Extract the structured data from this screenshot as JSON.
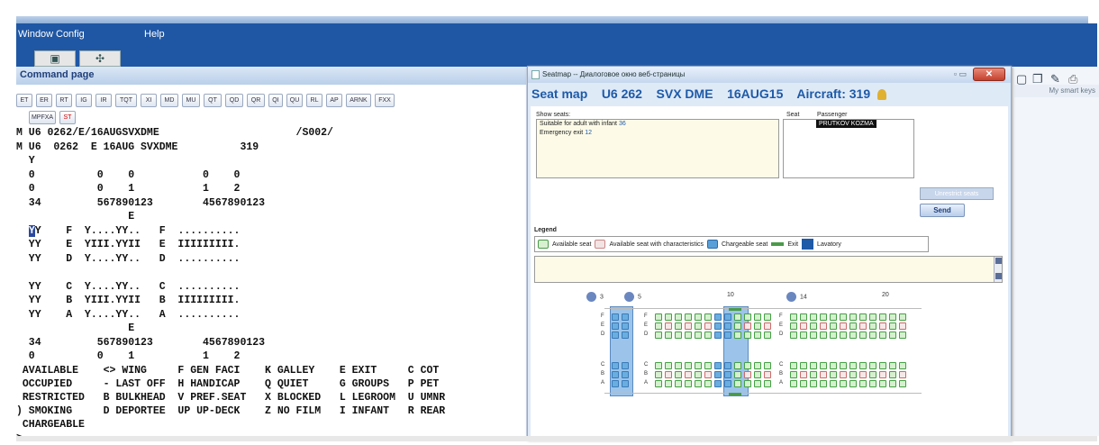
{
  "menu": {
    "window": "Window",
    "config": "Config",
    "help": "Help"
  },
  "command_page": {
    "title": "Command page"
  },
  "toolbar": {
    "buttons": [
      "ET",
      "ER",
      "RT",
      "IG",
      "IR",
      "TQT",
      "XI",
      "MD",
      "MU",
      "QT",
      "QD",
      "QR",
      "QI",
      "QU",
      "RL",
      "AP",
      "ARNK",
      "FXX"
    ],
    "row2": [
      "MPFXA",
      "ST"
    ]
  },
  "terminal": {
    "lines": [
      "M U6 0262/E/16AUGSVXDME                      /S002/",
      "M U6  0262  E 16AUG SVXDME          319",
      "  Y",
      "  0          0    0           0    0",
      "  0          0    1           1    2",
      "  34         567890123        4567890123",
      "                  E",
      "  YY    F  Y....YY..   F  ..........",
      "  YY    E  YIII.YYII   E  IIIIIIIII.",
      "  YY    D  Y....YY..   D  ..........",
      "",
      "  YY    C  Y....YY..   C  ..........",
      "  YY    B  YIII.YYII   B  IIIIIIIII.",
      "  YY    A  Y....YY..   A  ..........",
      "                  E",
      "  34         567890123        4567890123",
      "  0          0    1           1    2",
      " AVAILABLE    <> WING     F GEN FACI    K GALLEY    E EXIT     C COT",
      " OCCUPIED     - LAST OFF  H HANDICAP    Q QUIET     G GROUPS   P PET",
      " RESTRICTED   B BULKHEAD  V PREF.SEAT   X BLOCKED   L LEGROOM  U UMNR",
      ") SMOKING     D DEPORTEE  UP UP-DECK    Z NO FILM   I INFANT   R REAR",
      " CHARGEABLE",
      ">"
    ]
  },
  "seatmap_window": {
    "title": "Seatmap -- Диалоговое окно веб-страницы",
    "header": {
      "label": "Seat map",
      "flight": "U6 262",
      "route": "SVX DME",
      "date": "16AUG15",
      "aircraft": "Aircraft: 319"
    },
    "show_seats_label": "Show seats:",
    "show_seats": [
      {
        "text": "Suitable for adult with infant",
        "value": "36"
      },
      {
        "text": "Emergency exit",
        "value": "12"
      }
    ],
    "seat_col": "Seat",
    "passenger_col": "Passenger",
    "passenger_name": "PRUTKOV KOZMA",
    "unrestrict_button": "Unrestrict seats",
    "send_button": "Send",
    "legend_label": "Legend",
    "legend": [
      "Available seat",
      "Available seat with characteristics",
      "Chargeable seat",
      "Exit",
      "Lavatory"
    ],
    "row_numbers": [
      "3",
      "5",
      "10",
      "14",
      "20"
    ],
    "row_letters": [
      "F",
      "E",
      "D",
      "C",
      "B",
      "A"
    ]
  },
  "right_panel": {
    "smart_keys": "My smart keys"
  },
  "colors": {
    "menu_blue": "#1f57a4",
    "title_blue": "#1e5aa8",
    "available": "#d6f0cf",
    "chargeable": "#6aaee0"
  }
}
